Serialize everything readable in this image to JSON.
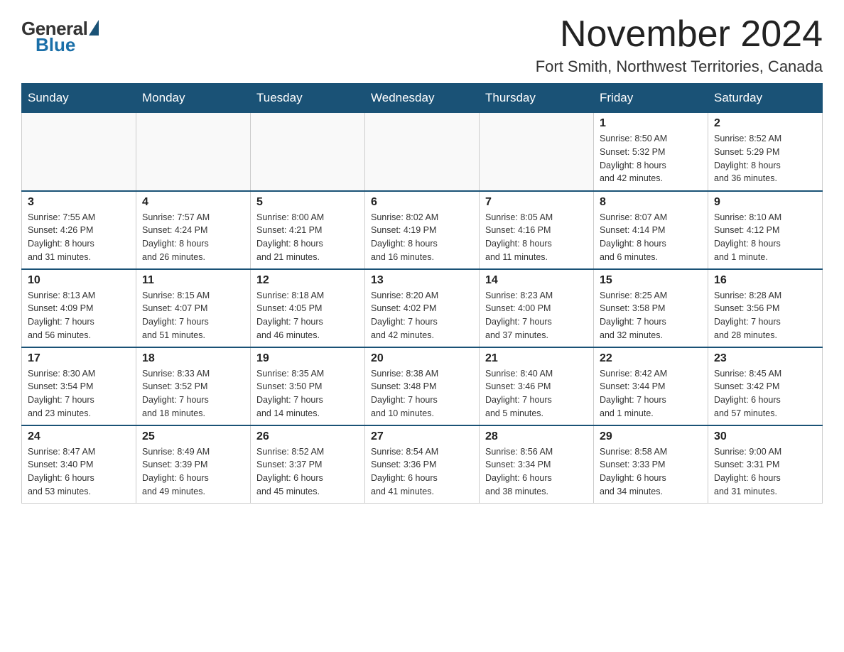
{
  "logo": {
    "general": "General",
    "blue": "Blue"
  },
  "header": {
    "month": "November 2024",
    "location": "Fort Smith, Northwest Territories, Canada"
  },
  "days_of_week": [
    "Sunday",
    "Monday",
    "Tuesday",
    "Wednesday",
    "Thursday",
    "Friday",
    "Saturday"
  ],
  "weeks": [
    [
      {
        "day": "",
        "info": ""
      },
      {
        "day": "",
        "info": ""
      },
      {
        "day": "",
        "info": ""
      },
      {
        "day": "",
        "info": ""
      },
      {
        "day": "",
        "info": ""
      },
      {
        "day": "1",
        "info": "Sunrise: 8:50 AM\nSunset: 5:32 PM\nDaylight: 8 hours\nand 42 minutes."
      },
      {
        "day": "2",
        "info": "Sunrise: 8:52 AM\nSunset: 5:29 PM\nDaylight: 8 hours\nand 36 minutes."
      }
    ],
    [
      {
        "day": "3",
        "info": "Sunrise: 7:55 AM\nSunset: 4:26 PM\nDaylight: 8 hours\nand 31 minutes."
      },
      {
        "day": "4",
        "info": "Sunrise: 7:57 AM\nSunset: 4:24 PM\nDaylight: 8 hours\nand 26 minutes."
      },
      {
        "day": "5",
        "info": "Sunrise: 8:00 AM\nSunset: 4:21 PM\nDaylight: 8 hours\nand 21 minutes."
      },
      {
        "day": "6",
        "info": "Sunrise: 8:02 AM\nSunset: 4:19 PM\nDaylight: 8 hours\nand 16 minutes."
      },
      {
        "day": "7",
        "info": "Sunrise: 8:05 AM\nSunset: 4:16 PM\nDaylight: 8 hours\nand 11 minutes."
      },
      {
        "day": "8",
        "info": "Sunrise: 8:07 AM\nSunset: 4:14 PM\nDaylight: 8 hours\nand 6 minutes."
      },
      {
        "day": "9",
        "info": "Sunrise: 8:10 AM\nSunset: 4:12 PM\nDaylight: 8 hours\nand 1 minute."
      }
    ],
    [
      {
        "day": "10",
        "info": "Sunrise: 8:13 AM\nSunset: 4:09 PM\nDaylight: 7 hours\nand 56 minutes."
      },
      {
        "day": "11",
        "info": "Sunrise: 8:15 AM\nSunset: 4:07 PM\nDaylight: 7 hours\nand 51 minutes."
      },
      {
        "day": "12",
        "info": "Sunrise: 8:18 AM\nSunset: 4:05 PM\nDaylight: 7 hours\nand 46 minutes."
      },
      {
        "day": "13",
        "info": "Sunrise: 8:20 AM\nSunset: 4:02 PM\nDaylight: 7 hours\nand 42 minutes."
      },
      {
        "day": "14",
        "info": "Sunrise: 8:23 AM\nSunset: 4:00 PM\nDaylight: 7 hours\nand 37 minutes."
      },
      {
        "day": "15",
        "info": "Sunrise: 8:25 AM\nSunset: 3:58 PM\nDaylight: 7 hours\nand 32 minutes."
      },
      {
        "day": "16",
        "info": "Sunrise: 8:28 AM\nSunset: 3:56 PM\nDaylight: 7 hours\nand 28 minutes."
      }
    ],
    [
      {
        "day": "17",
        "info": "Sunrise: 8:30 AM\nSunset: 3:54 PM\nDaylight: 7 hours\nand 23 minutes."
      },
      {
        "day": "18",
        "info": "Sunrise: 8:33 AM\nSunset: 3:52 PM\nDaylight: 7 hours\nand 18 minutes."
      },
      {
        "day": "19",
        "info": "Sunrise: 8:35 AM\nSunset: 3:50 PM\nDaylight: 7 hours\nand 14 minutes."
      },
      {
        "day": "20",
        "info": "Sunrise: 8:38 AM\nSunset: 3:48 PM\nDaylight: 7 hours\nand 10 minutes."
      },
      {
        "day": "21",
        "info": "Sunrise: 8:40 AM\nSunset: 3:46 PM\nDaylight: 7 hours\nand 5 minutes."
      },
      {
        "day": "22",
        "info": "Sunrise: 8:42 AM\nSunset: 3:44 PM\nDaylight: 7 hours\nand 1 minute."
      },
      {
        "day": "23",
        "info": "Sunrise: 8:45 AM\nSunset: 3:42 PM\nDaylight: 6 hours\nand 57 minutes."
      }
    ],
    [
      {
        "day": "24",
        "info": "Sunrise: 8:47 AM\nSunset: 3:40 PM\nDaylight: 6 hours\nand 53 minutes."
      },
      {
        "day": "25",
        "info": "Sunrise: 8:49 AM\nSunset: 3:39 PM\nDaylight: 6 hours\nand 49 minutes."
      },
      {
        "day": "26",
        "info": "Sunrise: 8:52 AM\nSunset: 3:37 PM\nDaylight: 6 hours\nand 45 minutes."
      },
      {
        "day": "27",
        "info": "Sunrise: 8:54 AM\nSunset: 3:36 PM\nDaylight: 6 hours\nand 41 minutes."
      },
      {
        "day": "28",
        "info": "Sunrise: 8:56 AM\nSunset: 3:34 PM\nDaylight: 6 hours\nand 38 minutes."
      },
      {
        "day": "29",
        "info": "Sunrise: 8:58 AM\nSunset: 3:33 PM\nDaylight: 6 hours\nand 34 minutes."
      },
      {
        "day": "30",
        "info": "Sunrise: 9:00 AM\nSunset: 3:31 PM\nDaylight: 6 hours\nand 31 minutes."
      }
    ]
  ]
}
